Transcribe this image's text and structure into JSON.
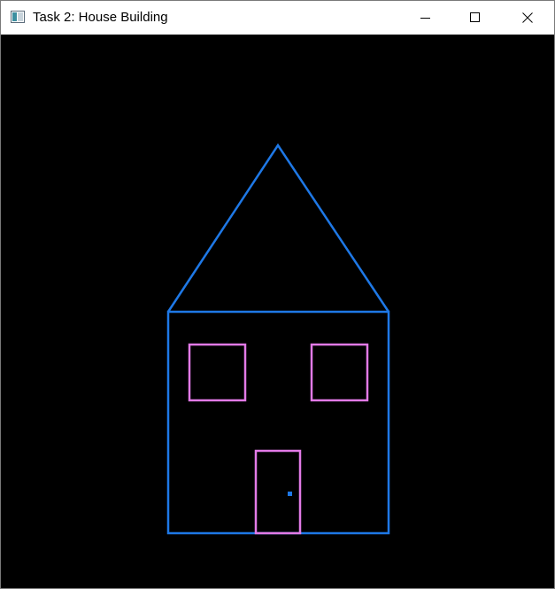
{
  "window": {
    "title": "Task 2: House Building",
    "controls": {
      "minimize_icon": "minimize-icon",
      "maximize_icon": "maximize-icon",
      "close_icon": "close-icon"
    }
  },
  "scene": {
    "background_color": "#000000",
    "house_color": "#1e78e6",
    "window_door_color": "#e27ae6",
    "knob_color": "#1e78e6"
  }
}
